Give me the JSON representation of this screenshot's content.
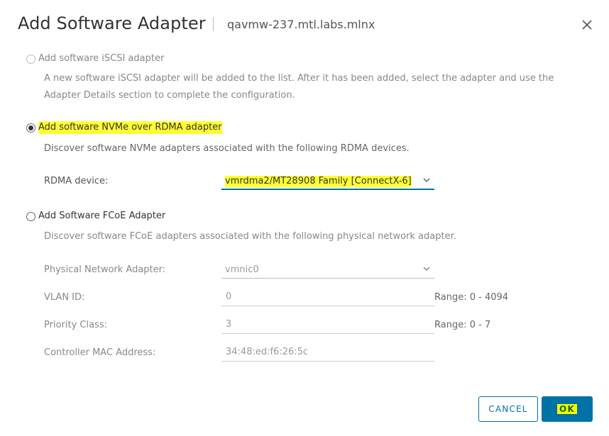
{
  "header": {
    "title": "Add Software Adapter",
    "host": "qavmw-237.mtl.labs.mlnx"
  },
  "iscsi": {
    "label": "Add software iSCSI adapter",
    "description": "A new software iSCSI adapter will be added to the list. After it has been added, select the adapter and use the Adapter Details section to complete the configuration."
  },
  "nvme": {
    "label": "Add software NVMe over RDMA adapter",
    "description": "Discover software NVMe adapters associated with the following RDMA devices.",
    "rdma_label": "RDMA device:",
    "rdma_value": "vmrdma2/MT28908 Family [ConnectX-6]"
  },
  "fcoe": {
    "label": "Add Software FCoE Adapter",
    "description": "Discover software FCoE adapters associated with the following physical network adapter.",
    "pna_label": "Physical Network Adapter:",
    "pna_value": "vmnic0",
    "vlan_label": "VLAN ID:",
    "vlan_value": "0",
    "vlan_range": "Range: 0 - 4094",
    "priority_label": "Priority Class:",
    "priority_value": "3",
    "priority_range": "Range: 0 - 7",
    "mac_label": "Controller MAC Address:",
    "mac_value": "34:48:ed:f6:26:5c"
  },
  "buttons": {
    "cancel": "CANCEL",
    "ok": "OK"
  },
  "colors": {
    "primary": "#0072a3",
    "highlight": "#ffff33"
  }
}
